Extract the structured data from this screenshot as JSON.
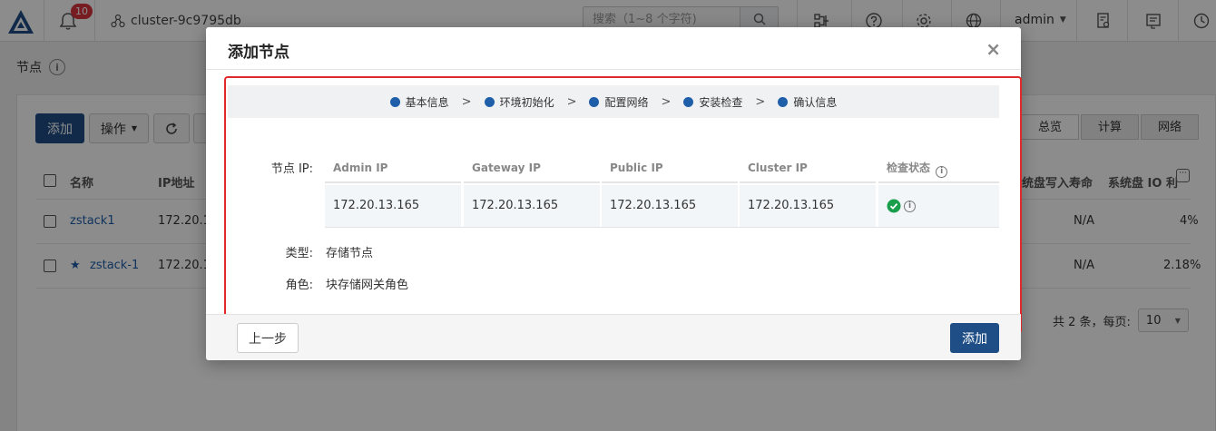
{
  "topbar": {
    "notification_count": "10",
    "cluster_name": "cluster-9c9795db",
    "search_placeholder": "搜索（1~8 个字符)",
    "user": "admin"
  },
  "page": {
    "title": "节点",
    "add_button": "添加",
    "actions_button": "操作",
    "tabs": [
      "总览",
      "计算",
      "网络"
    ],
    "columns": [
      "名称",
      "IP地址",
      "统盘写入寿命",
      "系统盘 IO 利"
    ],
    "rows": [
      {
        "name": "zstack1",
        "ip": "172.20.11",
        "life": "N/A",
        "io": "4%",
        "starred": false
      },
      {
        "name": "zstack-1",
        "ip": "172.20.1",
        "life": "N/A",
        "io": "2.18%",
        "starred": true
      }
    ],
    "pager_text": "共 2 条，每页:",
    "page_size": "10"
  },
  "modal": {
    "title": "添加节点",
    "close": "×",
    "steps": [
      "基本信息",
      "环境初始化",
      "配置网络",
      "安装检查",
      "确认信息"
    ],
    "node_ip_label": "节点 IP:",
    "ip_columns": [
      "Admin IP",
      "Gateway IP",
      "Public IP",
      "Cluster IP",
      "检查状态"
    ],
    "ip_row": [
      "172.20.13.165",
      "172.20.13.165",
      "172.20.13.165",
      "172.20.13.165"
    ],
    "type_label": "类型:",
    "type_value": "存储节点",
    "role_label": "角色:",
    "role_value": "块存储网关角色",
    "prev_button": "上一步",
    "submit_button": "添加"
  },
  "colors": {
    "primary": "#1f4e86",
    "step_dot": "#1f5ea8",
    "highlight": "#e02a2a",
    "ok": "#1a9e4b",
    "badge": "#d9363e"
  }
}
